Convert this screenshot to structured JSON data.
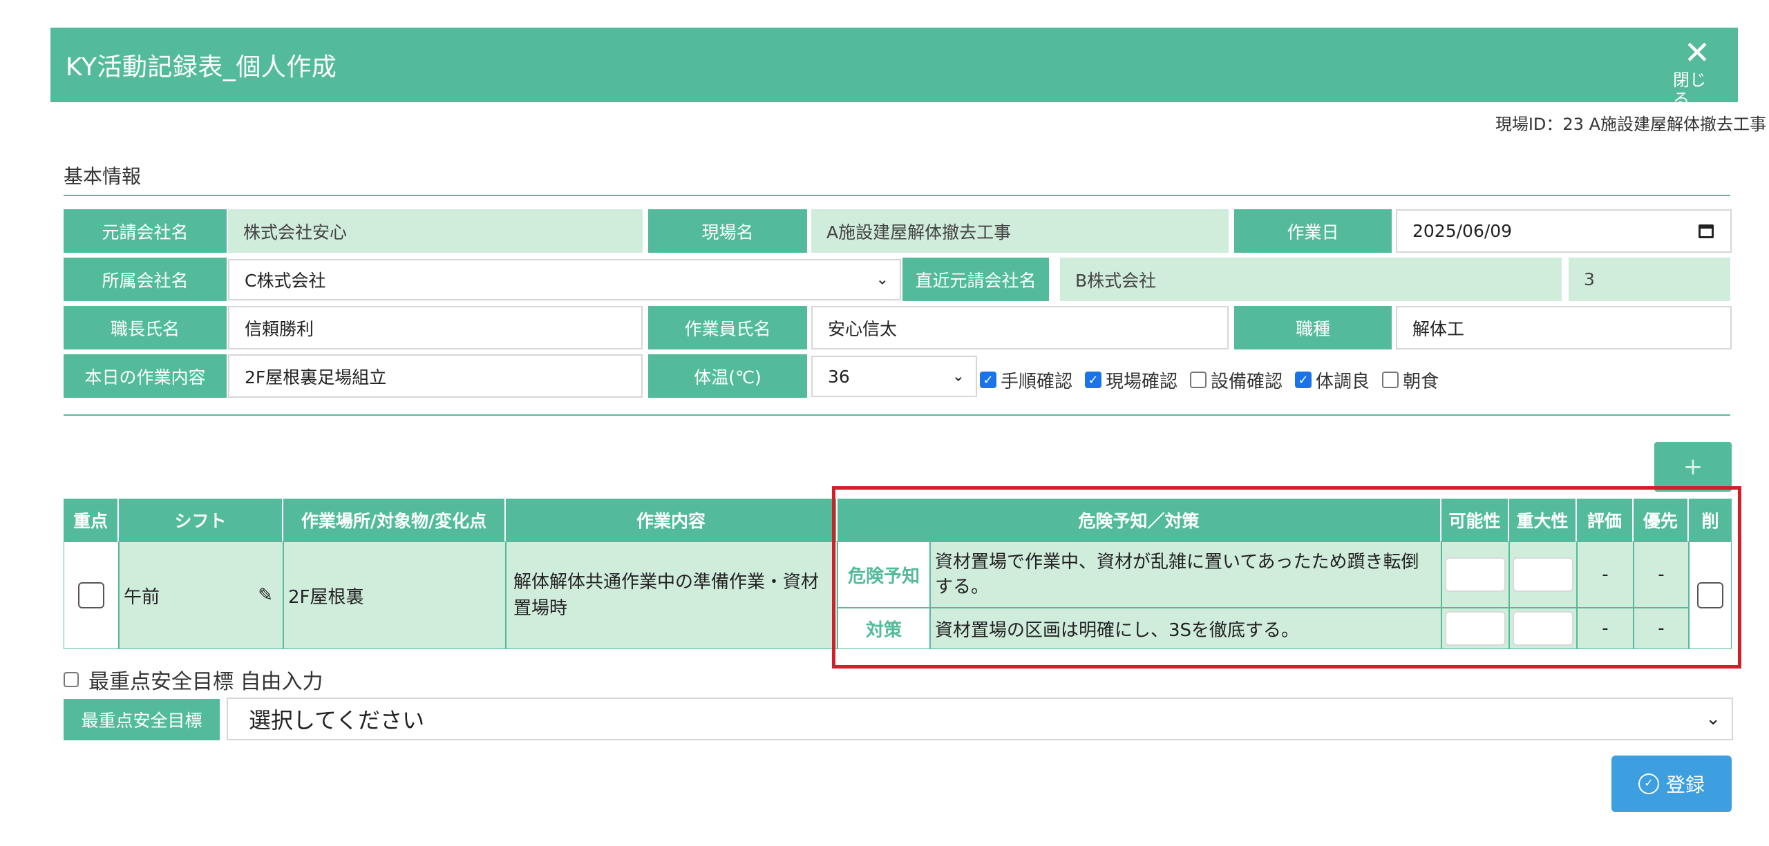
{
  "header": {
    "title": "KY活動記録表_個人作成",
    "close_label": "閉じる"
  },
  "site_id_text": "現場ID：23 A施設建屋解体撤去工事",
  "section_title": "基本情報",
  "info": {
    "prime_contractor_label": "元請会社名",
    "prime_contractor_value": "株式会社安心",
    "site_name_label": "現場名",
    "site_name_value": "A施設建屋解体撤去工事",
    "work_date_label": "作業日",
    "work_date_value": "2025/06/09",
    "affiliation_label": "所属会社名",
    "affiliation_value": "C株式会社",
    "direct_prime_label": "直近元請会社名",
    "direct_prime_value": "B株式会社",
    "direct_prime_extra": "3",
    "foreman_label": "職長氏名",
    "foreman_value": "信頼勝利",
    "worker_label": "作業員氏名",
    "worker_value": "安心信太",
    "job_type_label": "職種",
    "job_type_value": "解体工",
    "today_work_label": "本日の作業内容",
    "today_work_value": "2F屋根裏足場組立",
    "temp_label": "体温(℃)",
    "temp_value": "36",
    "checks": [
      {
        "label": "手順確認",
        "checked": true
      },
      {
        "label": "現場確認",
        "checked": true
      },
      {
        "label": "設備確認",
        "checked": false
      },
      {
        "label": "体調良",
        "checked": true
      },
      {
        "label": "朝食",
        "checked": false
      }
    ]
  },
  "add_button_label": "+",
  "table": {
    "headers": [
      "重点",
      "シフト",
      "作業場所/対象物/変化点",
      "作業内容",
      "危険予知／対策",
      "可能性",
      "重大性",
      "評価",
      "優先",
      "削"
    ],
    "row": {
      "shift": "午前",
      "place": "2F屋根裏",
      "work": "解体解体共通作業中の準備作業・資材置場時",
      "hazard_tag": "危険予知",
      "hazard_text": "資材置場で作業中、資材が乱雑に置いてあったため躓き転倒する。",
      "measure_tag": "対策",
      "measure_text": "資材置場の区画は明確にし、3Sを徹底する。",
      "eval_1": "-",
      "prio_1": "-",
      "eval_2": "-",
      "prio_2": "-"
    }
  },
  "free_input_label": "最重点安全目標 自由入力",
  "goal_label": "最重点安全目標",
  "goal_select_value": "選択してください",
  "submit_label": "登録",
  "colors": {
    "primary": "#53bb9b",
    "light": "#d0ecdb",
    "highlight": "#d0202a",
    "submit": "#3d9ee0"
  }
}
